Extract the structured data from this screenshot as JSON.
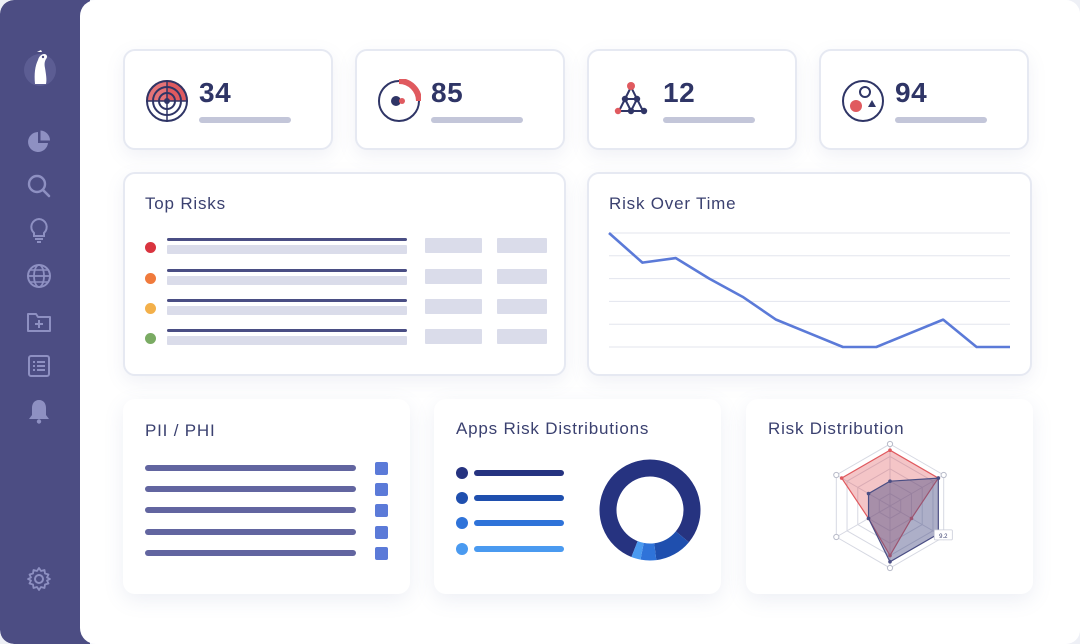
{
  "colors": {
    "sidebar": "#4c4d83",
    "accent_red": "#e05a5f",
    "navy": "#2f3566",
    "line_blue": "#5b7ad8"
  },
  "sidebar": {
    "logo": "meerkat-logo-icon",
    "items": [
      {
        "icon": "pie-chart-icon"
      },
      {
        "icon": "search-icon"
      },
      {
        "icon": "lightbulb-icon"
      },
      {
        "icon": "globe-icon"
      },
      {
        "icon": "folder-add-icon"
      },
      {
        "icon": "list-icon"
      },
      {
        "icon": "bell-icon"
      }
    ],
    "settings": {
      "icon": "gear-icon"
    }
  },
  "stats": [
    {
      "value": "34",
      "icon": "radar-target-icon"
    },
    {
      "value": "85",
      "icon": "gauge-ring-icon"
    },
    {
      "value": "12",
      "icon": "network-graph-icon"
    },
    {
      "value": "94",
      "icon": "shapes-icon"
    }
  ],
  "top_risks": {
    "title": "Top Risks",
    "rows": [
      {
        "severity_color": "#d9343f"
      },
      {
        "severity_color": "#f07a3c"
      },
      {
        "severity_color": "#f3b04a"
      },
      {
        "severity_color": "#7aab63"
      }
    ]
  },
  "risk_over_time": {
    "title": "Risk Over Time"
  },
  "pii": {
    "title": "PII / PHI",
    "rows": 5
  },
  "apps_risk": {
    "title": "Apps Risk Distributions",
    "legend_colors": [
      "#263380",
      "#1f4fae",
      "#2f73d9",
      "#4a9af0"
    ]
  },
  "risk_distribution": {
    "title": "Risk Distribution",
    "tooltip": "9.2"
  },
  "chart_data": [
    {
      "type": "line",
      "title": "Risk Over Time",
      "x": [
        1,
        2,
        3,
        4,
        5,
        6,
        7,
        8,
        9,
        10,
        11,
        12,
        13
      ],
      "values": [
        5.0,
        3.7,
        3.9,
        3.0,
        2.2,
        1.2,
        0.6,
        0.0,
        0.0,
        0.6,
        1.2,
        0.0,
        0.0
      ],
      "ylim": [
        0,
        5
      ],
      "grid": true
    },
    {
      "type": "pie",
      "title": "Apps Risk Distributions",
      "donut": true,
      "values": [
        80,
        12,
        5,
        3
      ],
      "colors": [
        "#263380",
        "#1f4fae",
        "#2f73d9",
        "#4a9af0"
      ]
    },
    {
      "type": "radar",
      "title": "Risk Distribution",
      "axes": 6,
      "rmax": 10,
      "series": [
        {
          "values": [
            9,
            9,
            4,
            8,
            4,
            9
          ],
          "color": "#e05a5f"
        },
        {
          "values": [
            4,
            9,
            9,
            9,
            4,
            4
          ],
          "color": "#4a4e84"
        }
      ]
    }
  ]
}
